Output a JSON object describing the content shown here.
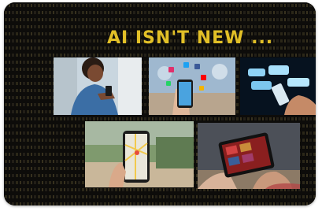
{
  "slide": {
    "headline": "AI ISN'T NEW ...",
    "accent_color": "#e2c027",
    "background_color": "#0c0c0c"
  },
  "images": [
    {
      "name": "woman-using-smartphone-photo"
    },
    {
      "name": "smartphone-social-media-icons-photo"
    },
    {
      "name": "chat-bubbles-phone-photo"
    },
    {
      "name": "hand-holding-phone-map-photo"
    },
    {
      "name": "tablet-streaming-photo"
    }
  ]
}
